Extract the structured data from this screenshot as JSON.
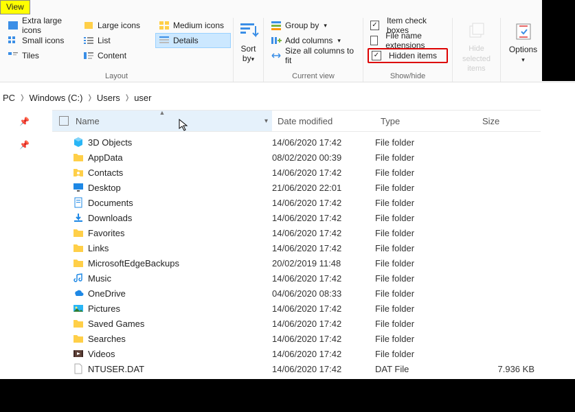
{
  "tab_label": "View",
  "ribbon": {
    "layout_label": "Layout",
    "items": [
      {
        "key": "xl",
        "label": "Extra large icons"
      },
      {
        "key": "lg",
        "label": "Large icons"
      },
      {
        "key": "md",
        "label": "Medium icons"
      },
      {
        "key": "sm",
        "label": "Small icons"
      },
      {
        "key": "ls",
        "label": "List"
      },
      {
        "key": "dt",
        "label": "Details",
        "active": true
      },
      {
        "key": "tl",
        "label": "Tiles"
      },
      {
        "key": "ct",
        "label": "Content"
      }
    ],
    "sort_label": "Sort by",
    "current_view_label": "Current view",
    "group_by": "Group by",
    "add_columns": "Add columns",
    "size_all": "Size all columns to fit",
    "showhide_label": "Show/hide",
    "item_check_boxes": "Item check boxes",
    "file_name_ext": "File name extensions",
    "hidden_items": "Hidden items",
    "hide_selected": "Hide selected items",
    "options": "Options"
  },
  "breadcrumb": [
    "PC",
    "Windows (C:)",
    "Users",
    "user"
  ],
  "columns": {
    "name": "Name",
    "date": "Date modified",
    "type": "Type",
    "size": "Size"
  },
  "rows": [
    {
      "icon": "3d",
      "name": "3D Objects",
      "date": "14/06/2020 17:42",
      "type": "File folder",
      "size": ""
    },
    {
      "icon": "fy",
      "name": "AppData",
      "date": "08/02/2020 00:39",
      "type": "File folder",
      "size": ""
    },
    {
      "icon": "contacts",
      "name": "Contacts",
      "date": "14/06/2020 17:42",
      "type": "File folder",
      "size": ""
    },
    {
      "icon": "desktop",
      "name": "Desktop",
      "date": "21/06/2020 22:01",
      "type": "File folder",
      "size": ""
    },
    {
      "icon": "docs",
      "name": "Documents",
      "date": "14/06/2020 17:42",
      "type": "File folder",
      "size": ""
    },
    {
      "icon": "dl",
      "name": "Downloads",
      "date": "14/06/2020 17:42",
      "type": "File folder",
      "size": ""
    },
    {
      "icon": "fy",
      "name": "Favorites",
      "date": "14/06/2020 17:42",
      "type": "File folder",
      "size": ""
    },
    {
      "icon": "fy",
      "name": "Links",
      "date": "14/06/2020 17:42",
      "type": "File folder",
      "size": ""
    },
    {
      "icon": "fy",
      "name": "MicrosoftEdgeBackups",
      "date": "20/02/2019 11:48",
      "type": "File folder",
      "size": ""
    },
    {
      "icon": "music",
      "name": "Music",
      "date": "14/06/2020 17:42",
      "type": "File folder",
      "size": ""
    },
    {
      "icon": "od",
      "name": "OneDrive",
      "date": "04/06/2020 08:33",
      "type": "File folder",
      "size": ""
    },
    {
      "icon": "pics",
      "name": "Pictures",
      "date": "14/06/2020 17:42",
      "type": "File folder",
      "size": ""
    },
    {
      "icon": "fy",
      "name": "Saved Games",
      "date": "14/06/2020 17:42",
      "type": "File folder",
      "size": ""
    },
    {
      "icon": "fy",
      "name": "Searches",
      "date": "14/06/2020 17:42",
      "type": "File folder",
      "size": ""
    },
    {
      "icon": "video",
      "name": "Videos",
      "date": "14/06/2020 17:42",
      "type": "File folder",
      "size": ""
    },
    {
      "icon": "file",
      "name": "NTUSER.DAT",
      "date": "14/06/2020 17:42",
      "type": "DAT File",
      "size": "7.936 KB"
    }
  ]
}
